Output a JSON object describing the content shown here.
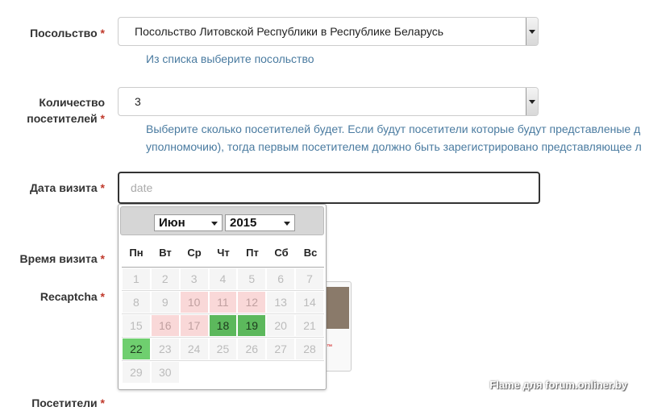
{
  "embassy": {
    "label": "Посольство",
    "required": "*",
    "value": "Посольство Литовской Республики в Республике Беларусь",
    "help": "Из списка выберите посольство"
  },
  "visitors_count": {
    "label_line1": "Количество",
    "label_line2": "посетителей",
    "required": "*",
    "value": "3",
    "help_line1": "Выберите сколько посетителей будет. Если будут посетители которые будут представленые д",
    "help_line2": "уполномочию), тогда первым посетителем должно быть зарегистрировано представляющее л"
  },
  "visit_date": {
    "label": "Дата визита",
    "required": "*",
    "placeholder": "date"
  },
  "visit_time": {
    "label": "Время визита",
    "required": "*"
  },
  "recaptcha": {
    "label": "Recaptcha",
    "required": "*",
    "tm": "™"
  },
  "visitors": {
    "label": "Посетители",
    "required": "*"
  },
  "calendar": {
    "month": "Июн",
    "year": "2015",
    "weekdays": [
      "Пн",
      "Вт",
      "Ср",
      "Чт",
      "Пт",
      "Сб",
      "Вс"
    ],
    "weeks": [
      [
        "1",
        "2",
        "3",
        "4",
        "5",
        "6",
        "7"
      ],
      [
        "8",
        "9",
        "10",
        "11",
        "12",
        "13",
        "14"
      ],
      [
        "15",
        "16",
        "17",
        "18",
        "19",
        "20",
        "21"
      ],
      [
        "22",
        "23",
        "24",
        "25",
        "26",
        "27",
        "28"
      ],
      [
        "29",
        "30",
        "",
        "",
        "",
        "",
        ""
      ]
    ],
    "unavailable_dates": [
      "10",
      "11",
      "12",
      "16",
      "17"
    ],
    "available_dates": [
      "18",
      "19",
      "22"
    ],
    "selected_date": "22",
    "colors": {
      "available": "#5cb85c",
      "unavailable": "#f9d8d8"
    }
  },
  "watermark": "Flame для forum.onliner.by"
}
